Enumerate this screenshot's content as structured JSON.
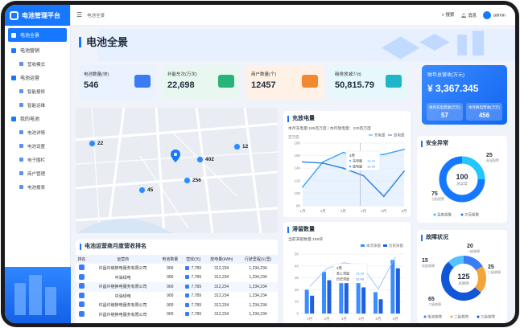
{
  "app": {
    "title": "电池管理平台"
  },
  "sidebar": {
    "items": [
      {
        "label": "电池全景",
        "active": true,
        "sub": false
      },
      {
        "label": "电池营销",
        "active": false,
        "sub": false
      },
      {
        "label": "营收模式",
        "active": false,
        "sub": true
      },
      {
        "label": "电池运营",
        "active": false,
        "sub": false
      },
      {
        "label": "智能报修",
        "active": false,
        "sub": true
      },
      {
        "label": "智能运维",
        "active": false,
        "sub": true
      },
      {
        "label": "我的电池",
        "active": false,
        "sub": false
      },
      {
        "label": "电池详情",
        "active": false,
        "sub": true
      },
      {
        "label": "电池设置",
        "active": false,
        "sub": true
      },
      {
        "label": "电子围栏",
        "active": false,
        "sub": true
      },
      {
        "label": "商户管理",
        "active": false,
        "sub": true
      },
      {
        "label": "电池报表",
        "active": false,
        "sub": true
      }
    ]
  },
  "topbar": {
    "breadcrumb": "电池全景",
    "search": "搜索",
    "messages": "消息",
    "user": "admin"
  },
  "page": {
    "title": "电池全景"
  },
  "stats": [
    {
      "label": "电池数量(块)",
      "value": "546"
    },
    {
      "label": "补能车次(万次)",
      "value": "22,698"
    },
    {
      "label": "商户数量(个)",
      "value": "12457"
    },
    {
      "label": "碳排放减少(t)",
      "value": "50,815.79"
    }
  ],
  "revenue": {
    "label": "财年总营收(万元)",
    "value": "¥ 3,367.345",
    "left_label": "本月充电营收(万元)",
    "left_value": "57",
    "right_label": "本月换电营收(万元)",
    "right_value": "456"
  },
  "map": {
    "pins": [
      "22",
      "402",
      "12",
      "45",
      "256"
    ]
  },
  "table": {
    "title": "电池运营商月度营收排名",
    "headers": [
      "排名",
      "运营商",
      "电池数量",
      "营收(元)",
      "放电量(kWh)",
      "行驶里程(公里)"
    ],
    "rows": [
      {
        "name": "许昌许继换电服务有限公司",
        "count": "900",
        "rev": "7,789",
        "kwh": "312,234",
        "km": "1,234,234"
      },
      {
        "name": "中油绿电",
        "count": "900",
        "rev": "7,789",
        "kwh": "312,234",
        "km": "1,234,234"
      },
      {
        "name": "许昌许继换电服务有限公司",
        "count": "900",
        "rev": "7,789",
        "kwh": "312,234",
        "km": "1,234,234"
      },
      {
        "name": "中油绿电",
        "count": "900",
        "rev": "7,789",
        "kwh": "312,234",
        "km": "1,234,234"
      },
      {
        "name": "许昌许继换电服务有限公司",
        "count": "900",
        "rev": "7,789",
        "kwh": "312,234",
        "km": "1,234,234"
      },
      {
        "name": "许昌许继换电服务有限公司",
        "count": "900",
        "rev": "7,789",
        "kwh": "312,234",
        "km": "1,234,234"
      }
    ]
  },
  "charge": {
    "title": "充放电量",
    "subtitle": "本月充电量:185百万度 / 本月放电量：230百万度",
    "unit": "百万度",
    "legend": [
      "充电量",
      "放电量"
    ],
    "tooltip": {
      "title": "4月",
      "charge_label": "充电量",
      "charge_value": "13.43",
      "discharge_label": "放电量",
      "discharge_value": "12.43",
      "unit": "百万度"
    },
    "chart_data": {
      "type": "line",
      "categories": [
        "1月",
        "2月",
        "3月",
        "4月",
        "5月",
        "6月"
      ],
      "ylim": [
        0,
        180
      ],
      "yticks": [
        "180",
        "160",
        "140",
        "120",
        "100",
        "80"
      ],
      "series": [
        {
          "name": "充电量",
          "values": [
            110,
            150,
            165,
            158,
            162,
            170
          ]
        },
        {
          "name": "放电量",
          "values": [
            150,
            148,
            140,
            128,
            95,
            135
          ]
        }
      ]
    }
  },
  "stranded": {
    "title": "滞留数量",
    "subtitle": "当前滞留数量:185块",
    "legend": [
      "本次滞留",
      "历史滞留"
    ],
    "tooltip": {
      "title": "3月",
      "a_label": "单上滞留",
      "a_value": "13.43",
      "b_label": "历史滞留",
      "b_value": "12.43"
    },
    "chart_data": {
      "type": "bar",
      "categories": [
        "1月",
        "2月",
        "3月",
        "4月",
        "5月",
        "6月"
      ],
      "ylim": [
        0,
        50
      ],
      "yticks": [
        "50",
        "40",
        "30",
        "20",
        "10",
        "0"
      ],
      "series": [
        {
          "name": "本次滞留",
          "values": [
            20,
            35,
            40,
            38,
            18,
            45
          ]
        },
        {
          "name": "历史滞留",
          "values": [
            15,
            28,
            30,
            22,
            12,
            38
          ]
        }
      ]
    }
  },
  "safety": {
    "title": "安全异常",
    "center_value": "100",
    "center_label": "总异常",
    "a_value": "25",
    "a_label": "高温报警",
    "b_value": "75",
    "b_label": "当前报警",
    "legend": [
      "温度报警",
      "欠压报警"
    ],
    "chart_data": {
      "type": "pie",
      "values": [
        25,
        75
      ],
      "labels": [
        "高温报警",
        "当前报警"
      ]
    }
  },
  "fault": {
    "title": "故障状况",
    "center_value": "125",
    "center_label": "总故障",
    "labels": [
      {
        "v": "20",
        "t": "一级故障"
      },
      {
        "v": "15",
        "t": "轻度故障"
      },
      {
        "v": "25",
        "t": "三级故障"
      },
      {
        "v": "65",
        "t": "二级故障"
      }
    ],
    "legend": [
      "电池故障",
      "二级故障",
      "三级故障"
    ],
    "chart_data": {
      "type": "pie",
      "values": [
        20,
        25,
        65,
        15
      ],
      "labels": [
        "一级故障",
        "三级故障",
        "二级故障",
        "轻度故障"
      ]
    }
  },
  "colors": {
    "accent": "#1677ff",
    "line1": "#3aa0ff",
    "line2": "#2a7fd8",
    "bar1": "#3a8dff",
    "bar2": "#1f5fe0",
    "donut_a": "#23c6ff",
    "donut_b": "#1677ff",
    "fault": [
      "#3a7cf4",
      "#f4a53a",
      "#1256d8",
      "#56c1ff"
    ]
  }
}
